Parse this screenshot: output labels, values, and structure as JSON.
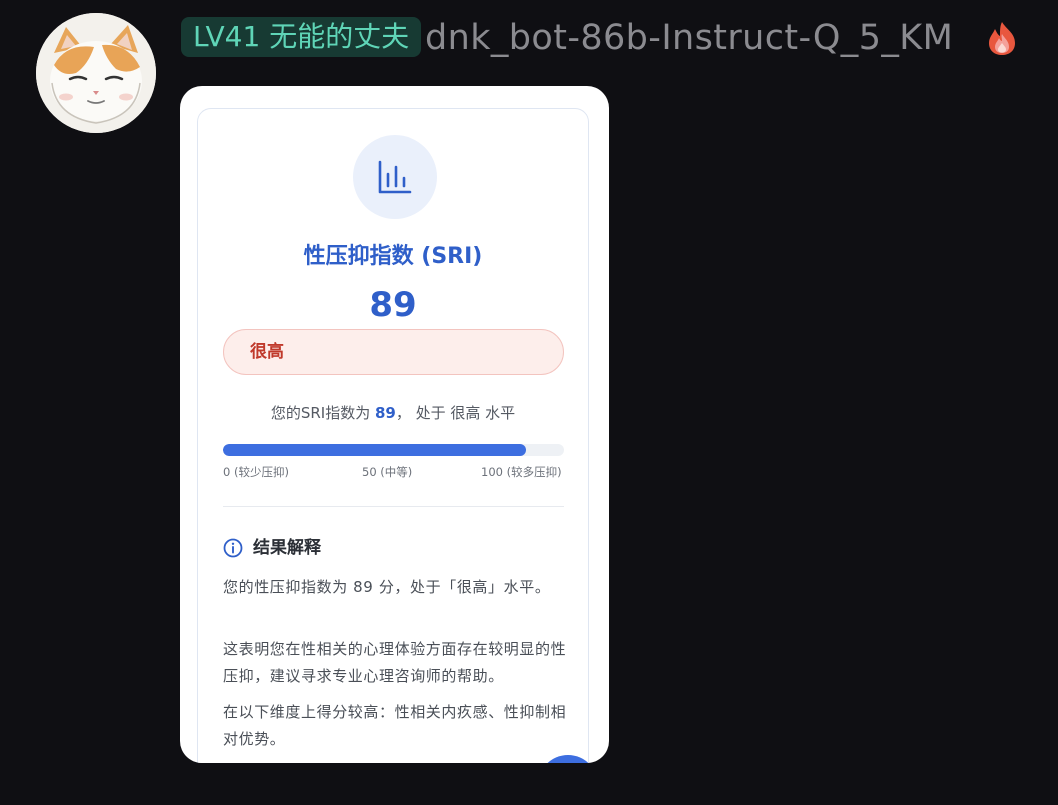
{
  "header": {
    "level_badge": "LV41 无能的丈夫",
    "username": "dnk_bot-86b-Instruct-Q_5_KM",
    "status_icon": "fire-icon",
    "avatar_icon": "cat-avatar"
  },
  "card": {
    "icon": "bar-chart-icon",
    "title": "性压抑指数 (SRI)",
    "score": "89",
    "level_label": "很高",
    "summary": {
      "prefix": "您的SRI指数为 ",
      "value": "89",
      "suffix": "， 处于 很高 水平"
    },
    "progress": {
      "value": 89,
      "max": 100,
      "min_label": "0 (较少压抑)",
      "mid_label": "50 (中等)",
      "max_label": "100 (较多压抑)"
    },
    "section": {
      "icon": "info-icon",
      "title": "结果解释",
      "paragraphs": [
        "您的性压抑指数为 89 分，处于「很高」水平。",
        "这表明您在性相关的心理体验方面存在较明显的性压抑，建议寻求专业心理咨询师的帮助。",
        "在以下维度上得分较高：性相关内疚感、性抑制相对优势。"
      ]
    },
    "fab_icon": "floating-action-button"
  },
  "colors": {
    "background": "#0f0f13",
    "badge_bg": "#173a33",
    "badge_text": "#5fd5b7",
    "username_text": "#8b8b90",
    "accent_blue": "#2f5fc9",
    "progress_fill": "#3d6ee0",
    "level_text": "#c0392b",
    "level_bg": "#fdeeeb"
  }
}
